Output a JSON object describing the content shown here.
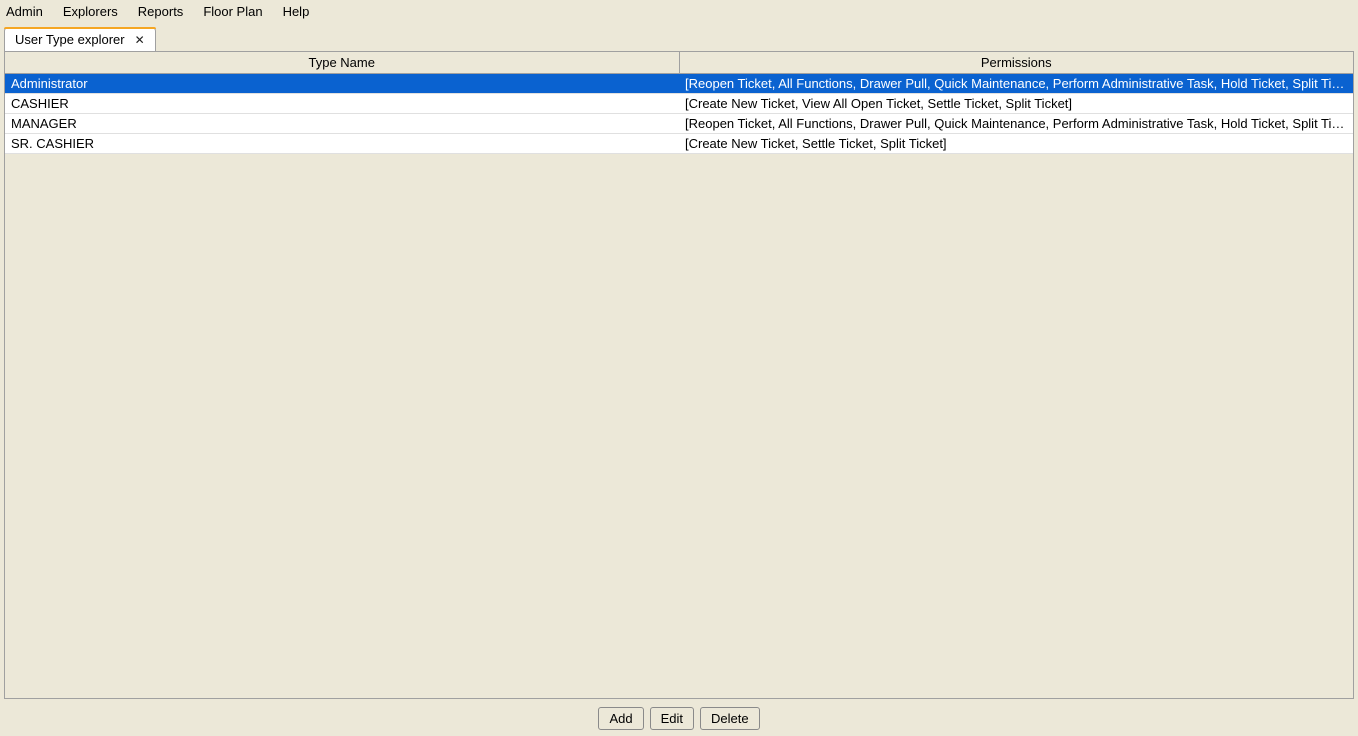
{
  "menubar": {
    "items": [
      "Admin",
      "Explorers",
      "Reports",
      "Floor Plan",
      "Help"
    ]
  },
  "tab": {
    "label": "User Type explorer"
  },
  "table": {
    "headers": {
      "type_name": "Type Name",
      "permissions": "Permissions"
    },
    "rows": [
      {
        "type_name": "Administrator",
        "permissions": "[Reopen Ticket, All Functions, Drawer Pull, Quick Maintenance, Perform Administrative Task, Hold Ticket, Split Ticket, Authori...",
        "selected": true
      },
      {
        "type_name": "CASHIER",
        "permissions": "[Create New Ticket, View All Open Ticket, Settle Ticket, Split Ticket]",
        "selected": false
      },
      {
        "type_name": "MANAGER",
        "permissions": "[Reopen Ticket, All Functions, Drawer Pull, Quick Maintenance, Perform Administrative Task, Hold Ticket, Split Ticket, Authori...",
        "selected": false
      },
      {
        "type_name": "SR. CASHIER",
        "permissions": "[Create New Ticket, Settle Ticket, Split Ticket]",
        "selected": false
      }
    ]
  },
  "buttons": {
    "add": "Add",
    "edit": "Edit",
    "delete": "Delete"
  }
}
